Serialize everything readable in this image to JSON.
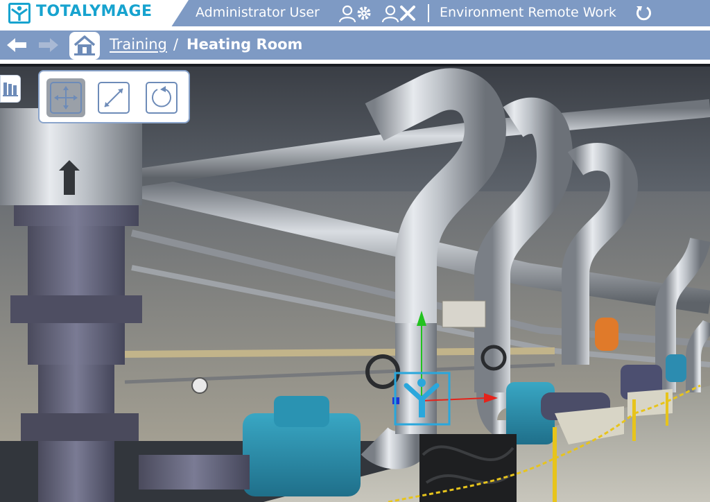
{
  "header": {
    "brand": "TOTALYMAGE",
    "user_name": "Administrator User",
    "environment": "Environment Remote Work",
    "icons": {
      "logo": "totalymage-logo-icon",
      "settings": "user-settings-icon",
      "logout": "user-logout-icon",
      "refresh": "refresh-icon"
    }
  },
  "nav": {
    "breadcrumb_link": "Training",
    "breadcrumb_separator": "/",
    "breadcrumb_current": "Heating Room",
    "icons": {
      "back": "arrow-left-icon",
      "forward": "arrow-right-icon",
      "home": "home-icon"
    }
  },
  "toolbar": {
    "tools": [
      {
        "name": "move",
        "icon": "move-arrows-icon",
        "active": true
      },
      {
        "name": "scale",
        "icon": "scale-diagonal-icon",
        "active": false
      },
      {
        "name": "rotate",
        "icon": "rotate-icon",
        "active": false
      }
    ],
    "library_icon": "library-books-icon"
  },
  "scene": {
    "description_icon": "panorama-heating-room",
    "gizmo_icon": "totalymage-marker-icon",
    "colors": {
      "axis_x": "#e5231b",
      "axis_y": "#22c21f",
      "axis_z": "#1a35d6",
      "marker": "#2aa7dc"
    }
  },
  "colors": {
    "bar": "#7e9ac4",
    "brand": "#17a3cf"
  }
}
